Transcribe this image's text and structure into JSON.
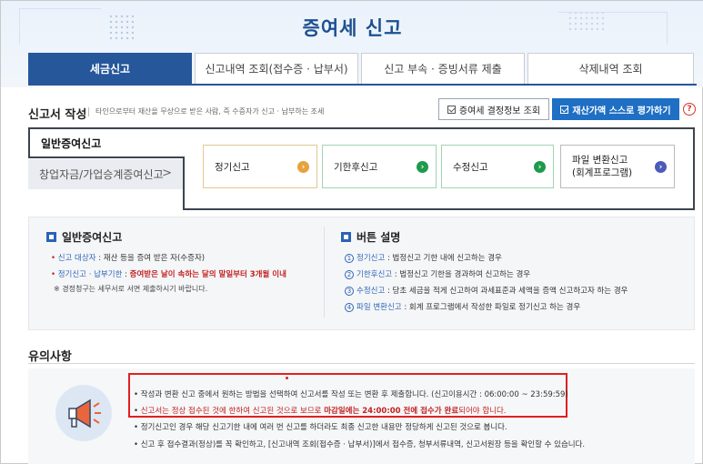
{
  "page": {
    "title": "증여세 신고"
  },
  "tabs": [
    {
      "label": "세금신고",
      "active": true
    },
    {
      "label": "신고내역 조회(접수증 · 납부서)",
      "active": false
    },
    {
      "label": "신고 부속 · 증빙서류 제출",
      "active": false
    },
    {
      "label": "삭제내역 조회",
      "active": false
    }
  ],
  "write": {
    "title": "신고서 작성",
    "desc": "타인으로부터 재산을 무상으로 받은 사람, 즉 수증자가 신고 · 납부하는 조세",
    "btn_decision": "증여세 결정정보 조회",
    "btn_self_eval": "재산가액 스스로 평가하기",
    "help": "?"
  },
  "report_types": [
    {
      "label": "일반증여신고",
      "selected": true
    },
    {
      "label": "창업자금/가업승계증여신고",
      "selected": false,
      "chevron": ">"
    }
  ],
  "options": [
    {
      "label": "정기신고",
      "color": "#e6a23c",
      "border": "#e2c98f"
    },
    {
      "label": "기한후신고",
      "color": "#1e9a4b",
      "border": "#9fd4b2"
    },
    {
      "label": "수정신고",
      "color": "#1e9a4b",
      "border": "#9fd4b2"
    },
    {
      "label": "파일 변환신고",
      "label2": "(회계프로그램)",
      "color": "#4b5bb8",
      "border": "#bbbbbb"
    }
  ],
  "info_left": {
    "title": "일반증여신고",
    "l1_key": "신고 대상자",
    "l1_val": " : 재산 등을 증여 받은 자(수증자)",
    "l2_key": "정기신고 · 납부기한",
    "l2_sep": " : ",
    "l2_val": "증여받은 날이 속하는 달의 말일부터 3개월 이내",
    "note": "※ 경정청구는 세무서로 서면 제출하시기 바랍니다."
  },
  "info_right": {
    "title": "버튼 설명",
    "items": [
      {
        "n": "1",
        "key": "정기신고",
        "val": " : 법정신고 기한 내에 신고하는 경우"
      },
      {
        "n": "2",
        "key": "기한후신고",
        "val": " : 법정신고 기한을 경과하여 신고하는 경우"
      },
      {
        "n": "3",
        "key": "수정신고",
        "val": " : 당초 세금을 적게 신고하여 과세표준과 세액을 증액 신고하고자 하는 경우"
      },
      {
        "n": "4",
        "key": "파일 변환신고",
        "val": " : 회계 프로그램에서 작성한 파일로 정기신고 하는 경우"
      }
    ]
  },
  "caution": {
    "title": "유의사항",
    "l1": "작성과 변환 신고 중에서 원하는 방법을 선택하여 신고서를 작성 또는 변환 후 제출합니다. (신고이용시간 : 06:00:00 ~ 23:59:59)",
    "l2_red1": "신고서는 정상 접수된 것에 한하여 신고된 것으로 보므로 ",
    "l2_red2": "마감일에는 24:00:00 전에 접수가 완료",
    "l2_tail": "되어야 합니다.",
    "l3": "정기신고인 경우 해당 신고기한 내에 여러 번 신고를 하더라도 최종 신고한 내용만 정당하게 신고된 것으로 봅니다.",
    "l4": "신고 후 접수결과(정상)를 꼭 확인하고, [신고내역 조회(접수증 · 납부서)]에서 접수증, 청부서류내역, 신고서원장 등을 확인할 수 있습니다."
  }
}
